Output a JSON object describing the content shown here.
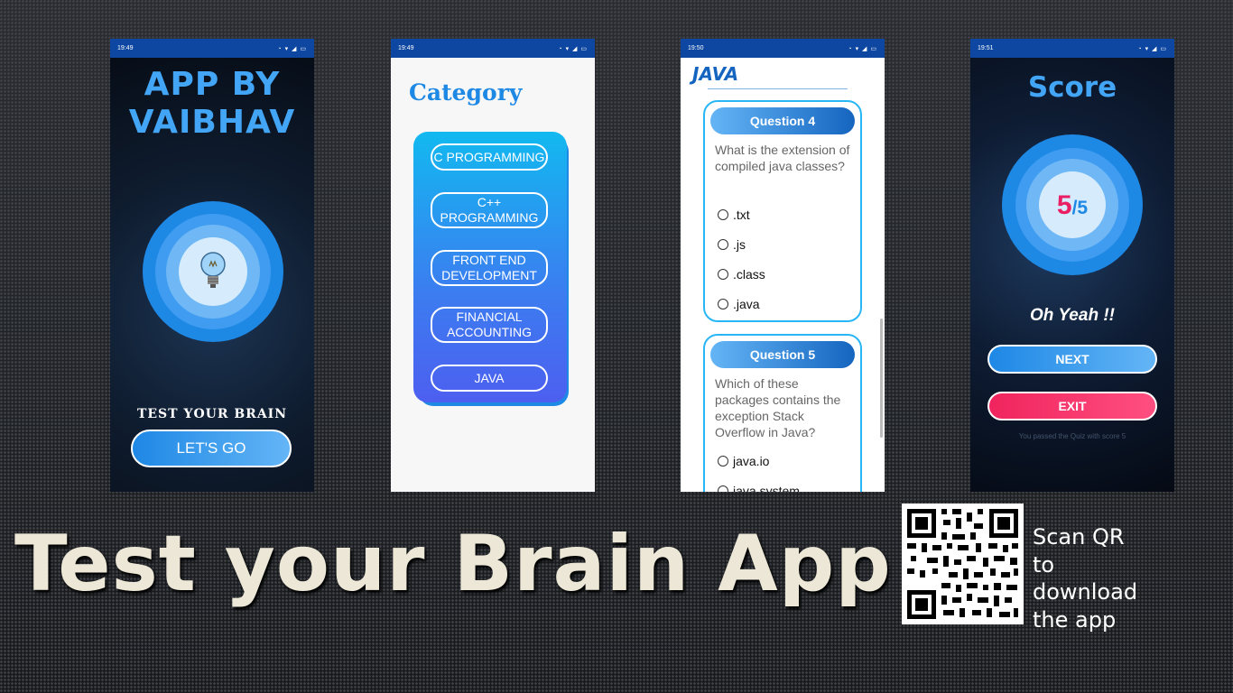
{
  "phone1": {
    "time": "19:49",
    "title_line1": "APP BY",
    "title_line2": "VAIBHAV",
    "tagline": "TEST YOUR BRAIN",
    "button": "LET'S GO",
    "icon": "lightbulb-icon"
  },
  "phone2": {
    "time": "19:49",
    "title": "Category",
    "categories": [
      "C PROGRAMMING",
      "C++ PROGRAMMING",
      "FRONT END DEVELOPMENT",
      "FINANCIAL ACCOUNTING",
      "JAVA"
    ]
  },
  "phone3": {
    "time": "19:50",
    "title": "JAVA",
    "questions": [
      {
        "label": "Question 4",
        "text": "What is the extension of compiled java classes?",
        "options": [
          ".txt",
          ".js",
          ".class",
          ".java"
        ]
      },
      {
        "label": "Question 5",
        "text": "Which of these packages contains the exception Stack Overflow in Java?",
        "options": [
          "java.io",
          "java.system"
        ]
      }
    ]
  },
  "phone4": {
    "time": "19:51",
    "title": "Score",
    "score": "5",
    "total": "/5",
    "message": "Oh Yeah !!",
    "next_button": "NEXT",
    "exit_button": "EXIT",
    "passed_text": "You passed the Quiz with score 5"
  },
  "headline": "Test your Brain App",
  "scan_text": "Scan QR to download the app",
  "colors": {
    "accent": "#42a5f5",
    "exit": "#f0245e",
    "score": "#e91e63"
  }
}
